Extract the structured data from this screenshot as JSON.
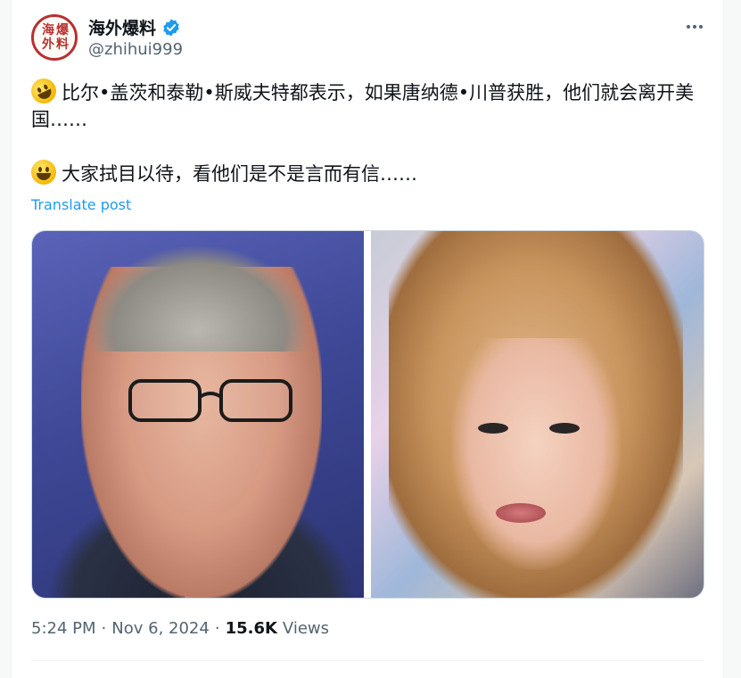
{
  "post": {
    "author": {
      "display_name": "海外爆料",
      "handle": "@zhihui999",
      "avatar_chars": [
        "海",
        "爆",
        "外",
        "料"
      ],
      "verified": true
    },
    "more_icon": "ellipsis-horizontal-icon",
    "text_line_1": "比尔•盖茨和泰勒•斯威夫特都表示，如果唐纳德•川普获胜，他们就会离开美国……",
    "text_line_2": "大家拭目以待，看他们是不是言而有信……",
    "emoji_1": "rolling-on-floor-laughing-emoji",
    "emoji_2": "grinning-face-emoji",
    "translate_label": "Translate post",
    "time": "5:24 PM",
    "separator_1": "·",
    "date": "Nov 6, 2024",
    "separator_2": "·",
    "views_count": "15.6K",
    "views_label": "Views"
  },
  "colors": {
    "link_blue": "#1d9bf0",
    "secondary_text": "#536471",
    "primary_text": "#0f1419",
    "avatar_red": "#b8312f"
  }
}
